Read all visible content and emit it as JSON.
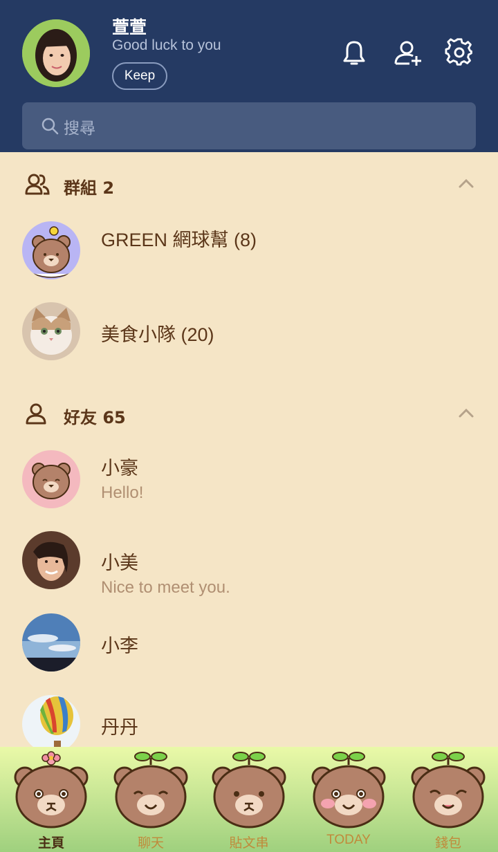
{
  "profile": {
    "name": "萱萱",
    "status": "Good luck to you",
    "keep_label": "Keep"
  },
  "search": {
    "placeholder": "搜尋"
  },
  "groups": {
    "title": "群組 2",
    "items": [
      {
        "name": "GREEN 網球幫 (8)"
      },
      {
        "name": "美食小隊 (20)"
      }
    ]
  },
  "friends": {
    "title": "好友 65",
    "items": [
      {
        "name": "小豪",
        "status": "Hello!"
      },
      {
        "name": "小美",
        "status": "Nice to meet you."
      },
      {
        "name": "小李"
      },
      {
        "name": "丹丹"
      }
    ]
  },
  "tabs": [
    {
      "label": "主頁",
      "icon": "bear-flower-icon"
    },
    {
      "label": "聊天",
      "icon": "bear-sprout-icon"
    },
    {
      "label": "貼文串",
      "icon": "bear-sprout-icon"
    },
    {
      "label": "TODAY",
      "icon": "bear-sprout-icon"
    },
    {
      "label": "錢包",
      "icon": "bear-sprout-icon"
    }
  ],
  "colors": {
    "header": "#253a63",
    "background": "#f5e5c6",
    "text": "#5b3619",
    "tab_active": "#4a2d14",
    "tab_inactive": "#c08a3b"
  }
}
